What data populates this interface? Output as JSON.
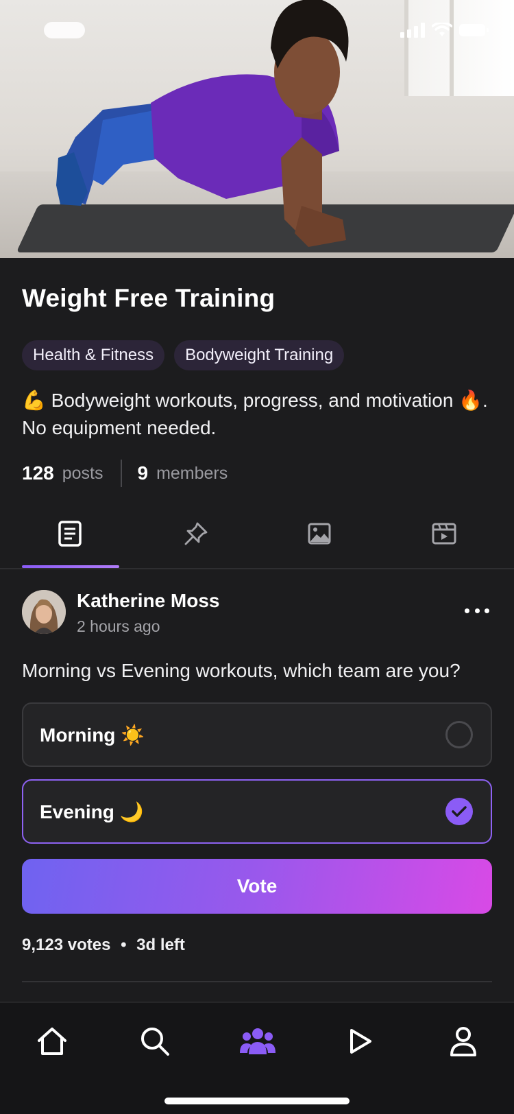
{
  "community": {
    "title": "Weight Free Training",
    "tags": [
      "Health & Fitness",
      "Bodyweight Training"
    ],
    "description": "💪 Bodyweight workouts, progress, and motivation 🔥. No equipment needed.",
    "stats": {
      "posts_count": "128",
      "posts_label": "posts",
      "members_count": "9",
      "members_label": "members"
    }
  },
  "tabs": [
    {
      "icon": "document-icon",
      "active": true
    },
    {
      "icon": "pin-icon",
      "active": false
    },
    {
      "icon": "image-icon",
      "active": false
    },
    {
      "icon": "video-icon",
      "active": false
    }
  ],
  "post": {
    "author": "Katherine Moss",
    "time": "2 hours ago",
    "question": "Morning vs Evening workouts, which team are you?",
    "options": [
      {
        "label": "Morning ☀️",
        "selected": false
      },
      {
        "label": "Evening 🌙",
        "selected": true
      }
    ],
    "vote_button": "Vote",
    "votes": "9,123 votes",
    "time_left": "3d left",
    "separator": "•"
  },
  "bottom_nav": [
    {
      "icon": "home-icon",
      "active": false
    },
    {
      "icon": "search-icon",
      "active": false
    },
    {
      "icon": "community-icon",
      "active": true
    },
    {
      "icon": "play-icon",
      "active": false
    },
    {
      "icon": "profile-icon",
      "active": false
    }
  ],
  "colors": {
    "background": "#1c1c1e",
    "accent": "#8b5cf6",
    "gradient_start": "#6f63f0",
    "gradient_end": "#d84ae6"
  }
}
